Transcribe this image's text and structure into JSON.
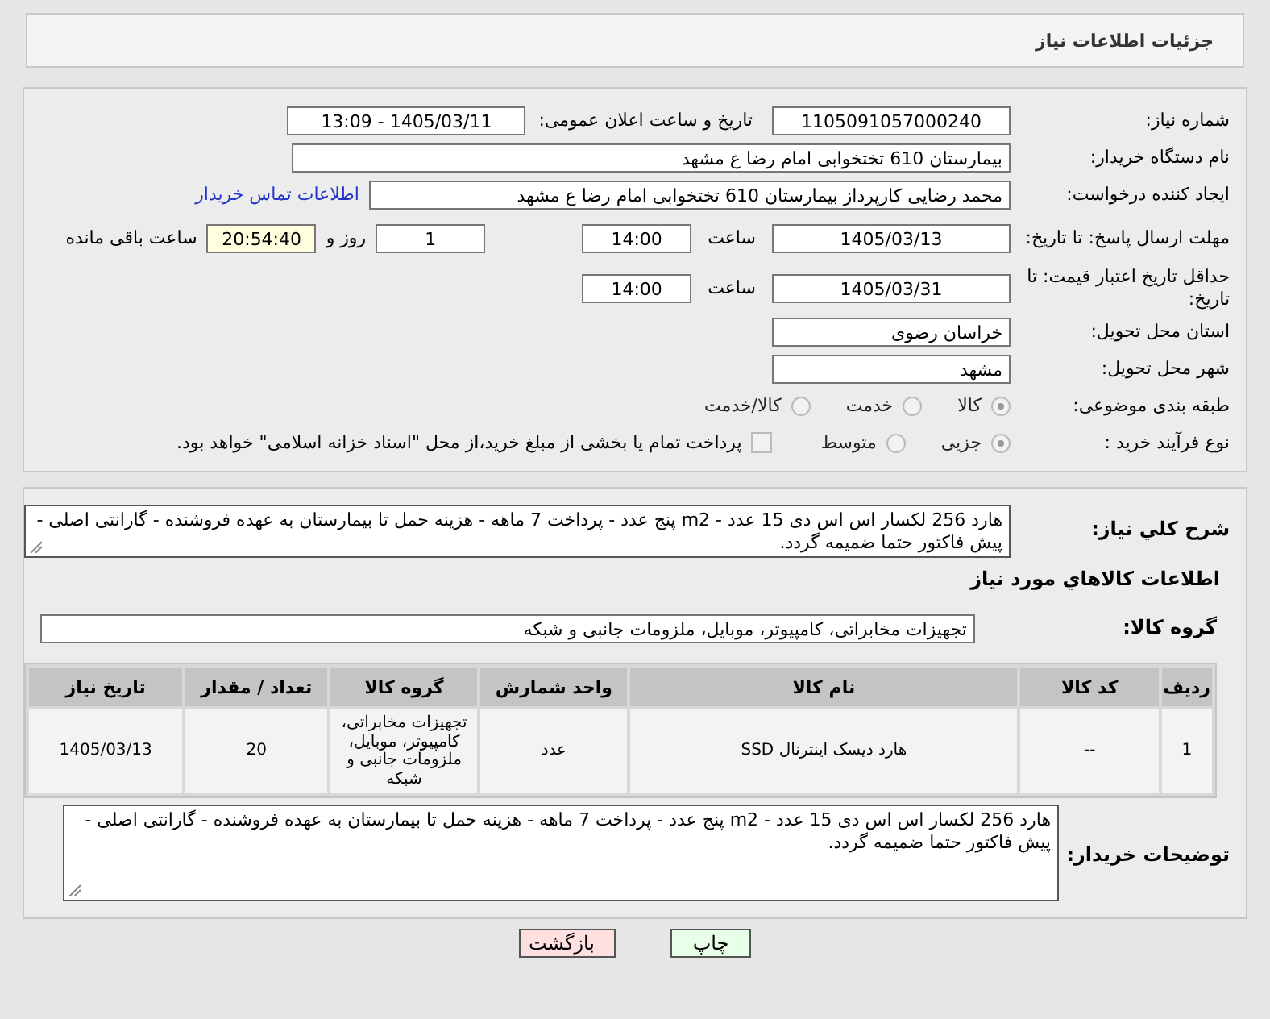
{
  "header": {
    "title": "جزئیات اطلاعات نیاز"
  },
  "need_number": {
    "label": "شماره نیاز:",
    "value": "1105091057000240"
  },
  "announce": {
    "label": "تاریخ و ساعت اعلان عمومی:",
    "value": "1405/03/11 - 13:09"
  },
  "buyer_org": {
    "label": "نام دستگاه خریدار:",
    "value": "بیمارستان 610 تختخوابی امام رضا ع  مشهد"
  },
  "requester": {
    "label": "ایجاد کننده درخواست:",
    "value": "محمد رضایی کارپرداز بیمارستان 610 تختخوابی امام رضا ع  مشهد",
    "link": "اطلاعات تماس خریدار"
  },
  "deadline": {
    "label": "مهلت ارسال پاسخ: تا تاریخ:",
    "date": "1405/03/13",
    "time_label": "ساعت",
    "time": "14:00",
    "days": "1",
    "days_label": "روز و",
    "remaining": "20:54:40",
    "remaining_label": "ساعت باقی مانده"
  },
  "price_validity": {
    "label": "حداقل تاریخ اعتبار قیمت: تا تاریخ:",
    "date": "1405/03/31",
    "time_label": "ساعت",
    "time": "14:00"
  },
  "province": {
    "label": "استان محل تحویل:",
    "value": "خراسان رضوی"
  },
  "city": {
    "label": "شهر محل تحویل:",
    "value": "مشهد"
  },
  "category": {
    "label": "طبقه بندی موضوعی:",
    "options": [
      {
        "label": "کالا",
        "selected": true
      },
      {
        "label": "خدمت",
        "selected": false
      },
      {
        "label": "کالا/خدمت",
        "selected": false
      }
    ]
  },
  "process": {
    "label": "نوع فرآیند خرید :",
    "options": [
      {
        "label": "جزیی",
        "selected": true
      },
      {
        "label": "متوسط",
        "selected": false
      }
    ],
    "payment": {
      "checked": false,
      "text": "پرداخت تمام یا بخشی از مبلغ خرید،از محل \"اسناد خزانه اسلامی\" خواهد بود."
    }
  },
  "description": {
    "label": "شرح کلي نياز:",
    "text": "هارد 256  لکسار اس اس دی 15 عدد - m2 پنج عدد - پرداخت 7 ماهه - هزینه حمل تا بیمارستان به عهده فروشنده - گارانتی اصلی - پیش فاکتور حتما ضمیمه گردد."
  },
  "goods_title": "اطلاعات کالاهاي مورد نياز",
  "goods_group": {
    "label": "گروه کالا:",
    "value": "تجهیزات مخابراتی، کامپیوتر، موبایل، ملزومات جانبی و شبکه"
  },
  "table": {
    "columns": [
      "ردیف",
      "کد کالا",
      "نام کالا",
      "واحد شمارش",
      "گروه کالا",
      "تعداد / مقدار",
      "تاریخ نیاز"
    ],
    "rows": [
      [
        "1",
        "--",
        "هارد دیسک اینترنال SSD",
        "عدد",
        "تجهیزات مخابراتی، کامپیوتر، موبایل، ملزومات جانبی و شبکه",
        "20",
        "1405/03/13"
      ]
    ]
  },
  "buyer_notes": {
    "label": "توضیحات خریدار:",
    "text": "هارد 256  لکسار اس اس دی 15 عدد - m2 پنج عدد - پرداخت 7 ماهه - هزینه حمل تا بیمارستان به عهده فروشنده - گارانتی اصلی - پیش فاکتور حتما ضمیمه گردد."
  },
  "buttons": [
    {
      "label": "چاپ",
      "kind": "print"
    },
    {
      "label": "بازگشت",
      "kind": "back"
    }
  ]
}
